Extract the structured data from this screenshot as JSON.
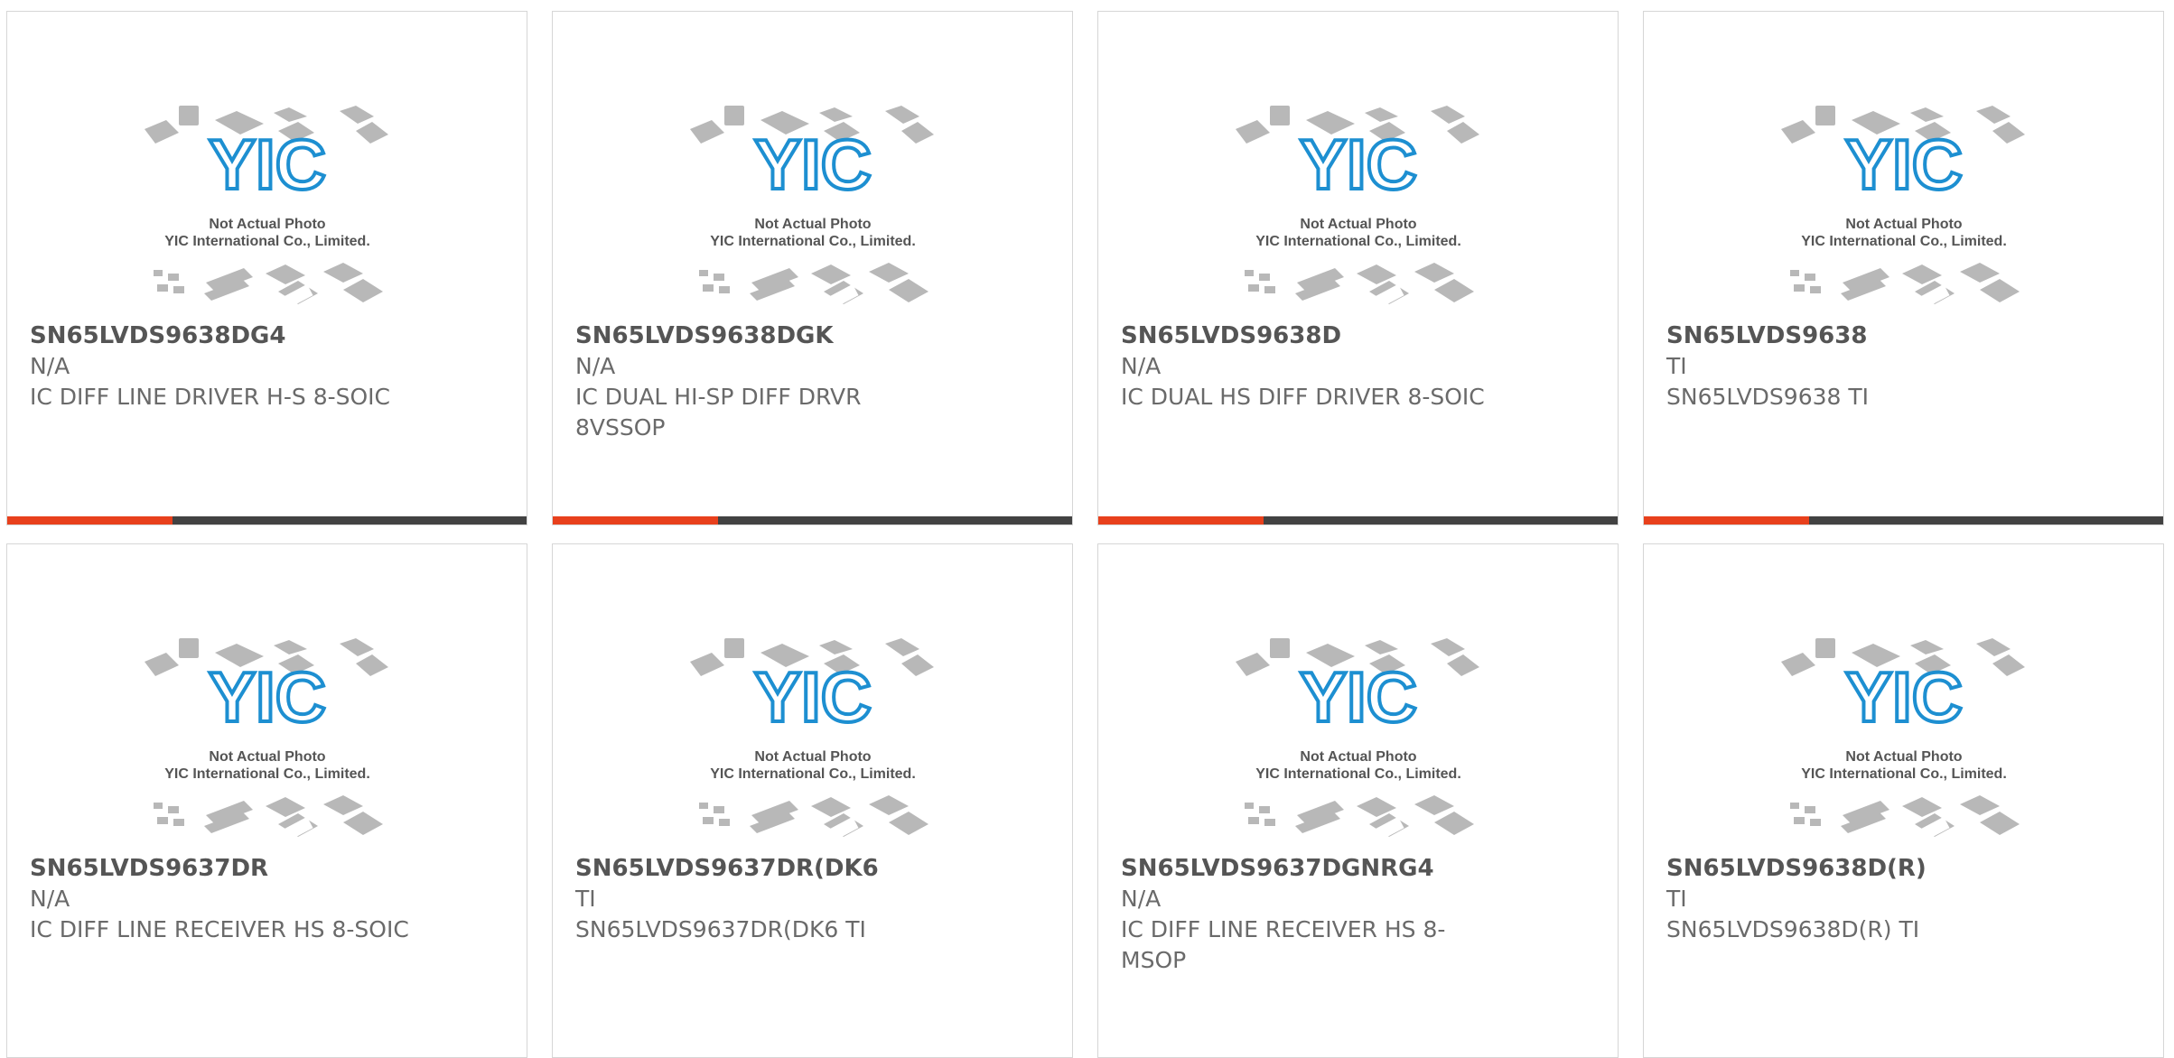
{
  "placeholder": {
    "line1": "Not Actual Photo",
    "line2": "YIC International Co., Limited.",
    "logo": "YIC"
  },
  "colors": {
    "accent": "#e8401c",
    "bar": "#424242",
    "logo_blue": "#1d8fd1",
    "chip_gray": "#b8b8b8"
  },
  "products": [
    {
      "part": "SN65LVDS9638DG4",
      "mfr": "N/A",
      "desc": "IC DIFF LINE DRIVER H-S 8-SOIC"
    },
    {
      "part": "SN65LVDS9638DGK",
      "mfr": "N/A",
      "desc": "IC DUAL HI-SP DIFF DRVR 8VSSOP"
    },
    {
      "part": "SN65LVDS9638D",
      "mfr": "N/A",
      "desc": "IC DUAL HS DIFF DRIVER 8-SOIC"
    },
    {
      "part": "SN65LVDS9638",
      "mfr": "TI",
      "desc": "SN65LVDS9638 TI"
    },
    {
      "part": "SN65LVDS9637DR",
      "mfr": "N/A",
      "desc": "IC DIFF LINE RECEIVER HS 8-SOIC"
    },
    {
      "part": "SN65LVDS9637DR(DK6",
      "mfr": "TI",
      "desc": "SN65LVDS9637DR(DK6 TI"
    },
    {
      "part": "SN65LVDS9637DGNRG4",
      "mfr": "N/A",
      "desc": "IC DIFF LINE RECEIVER HS 8-MSOP"
    },
    {
      "part": "SN65LVDS9638D(R)",
      "mfr": "TI",
      "desc": "SN65LVDS9638D(R) TI"
    }
  ]
}
